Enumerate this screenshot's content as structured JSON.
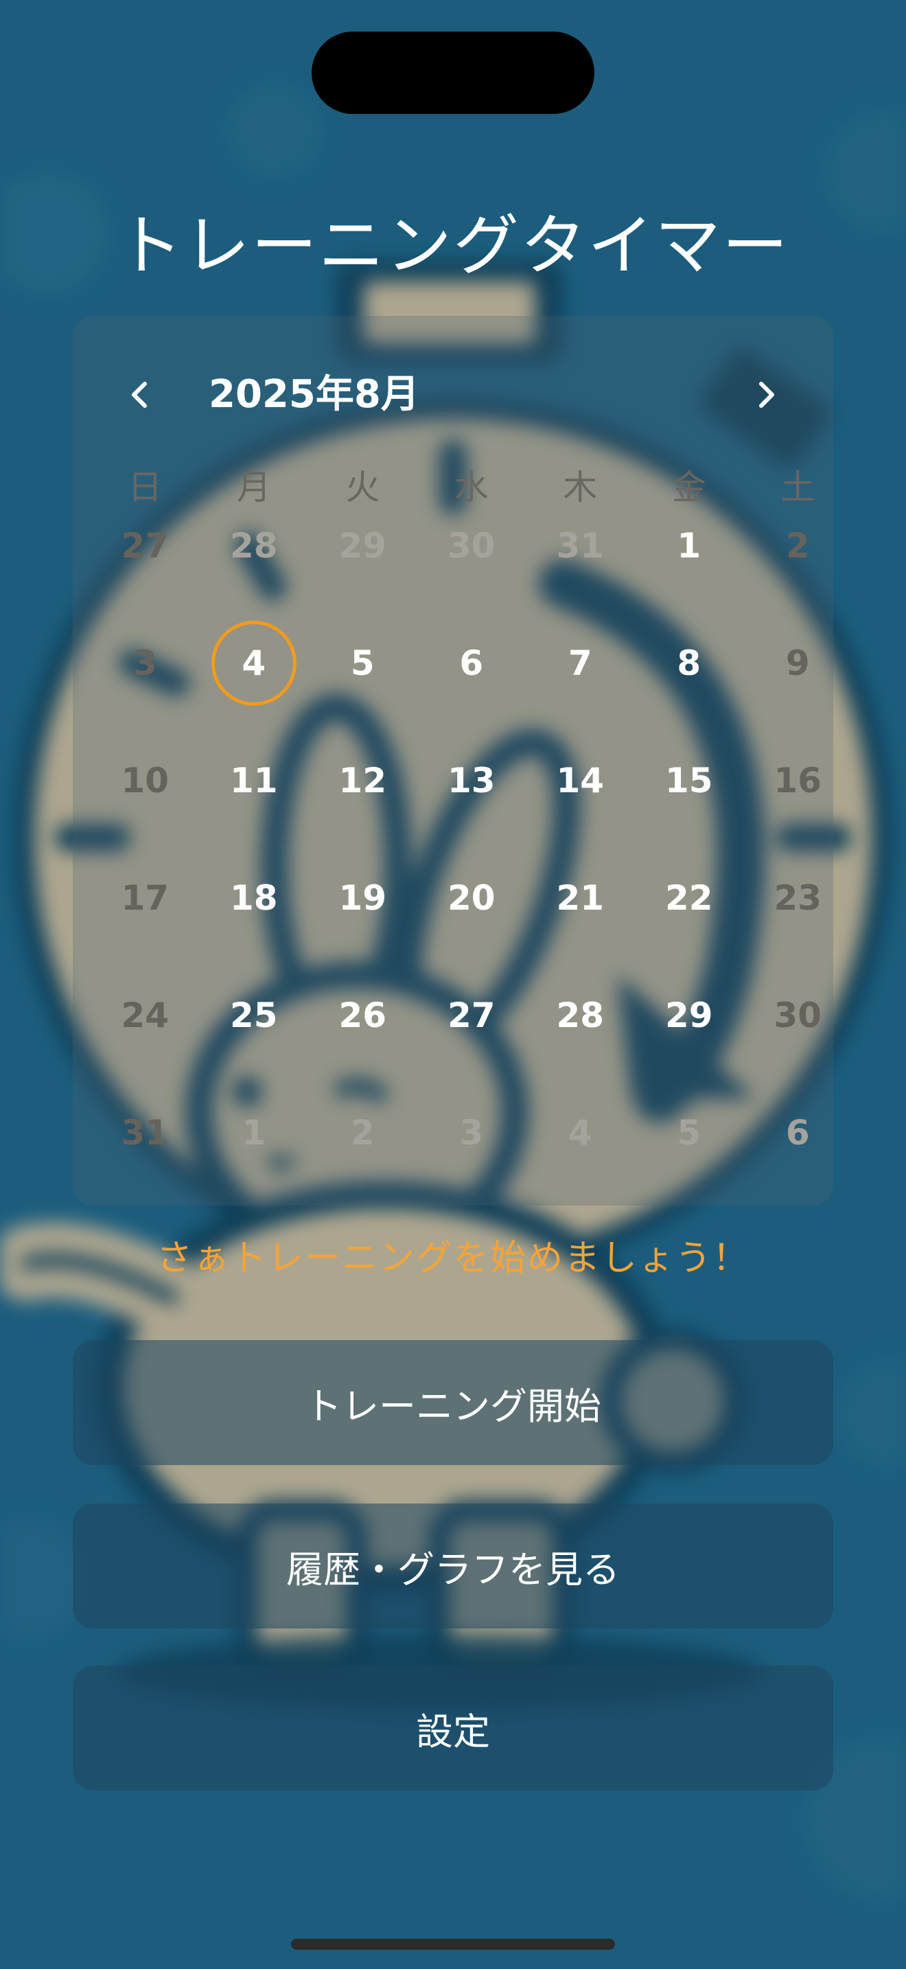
{
  "app": {
    "title": "トレーニングタイマー"
  },
  "calendar": {
    "month_label": "2025年8月",
    "prev_icon": "chevron-left-icon",
    "next_icon": "chevron-right-icon",
    "weekdays": [
      "日",
      "月",
      "火",
      "水",
      "木",
      "金",
      "土"
    ],
    "weeks": [
      [
        "27",
        "28",
        "29",
        "30",
        "31",
        "1",
        "2"
      ],
      [
        "3",
        "4",
        "5",
        "6",
        "7",
        "8",
        "9"
      ],
      [
        "10",
        "11",
        "12",
        "13",
        "14",
        "15",
        "16"
      ],
      [
        "17",
        "18",
        "19",
        "20",
        "21",
        "22",
        "23"
      ],
      [
        "24",
        "25",
        "26",
        "27",
        "28",
        "29",
        "30"
      ],
      [
        "31",
        "1",
        "2",
        "3",
        "4",
        "5",
        "6"
      ]
    ],
    "today": "4"
  },
  "message": "さぁトレーニングを始めましょう！",
  "buttons": {
    "start": "トレーニング開始",
    "history": "履歴・グラフを見る",
    "settings": "設定"
  },
  "colors": {
    "background": "#1c5d7d",
    "accent": "#f29b1f",
    "message": "#f4a43a",
    "art_fill": "#b5aa90",
    "art_stroke": "#0f3e57"
  }
}
